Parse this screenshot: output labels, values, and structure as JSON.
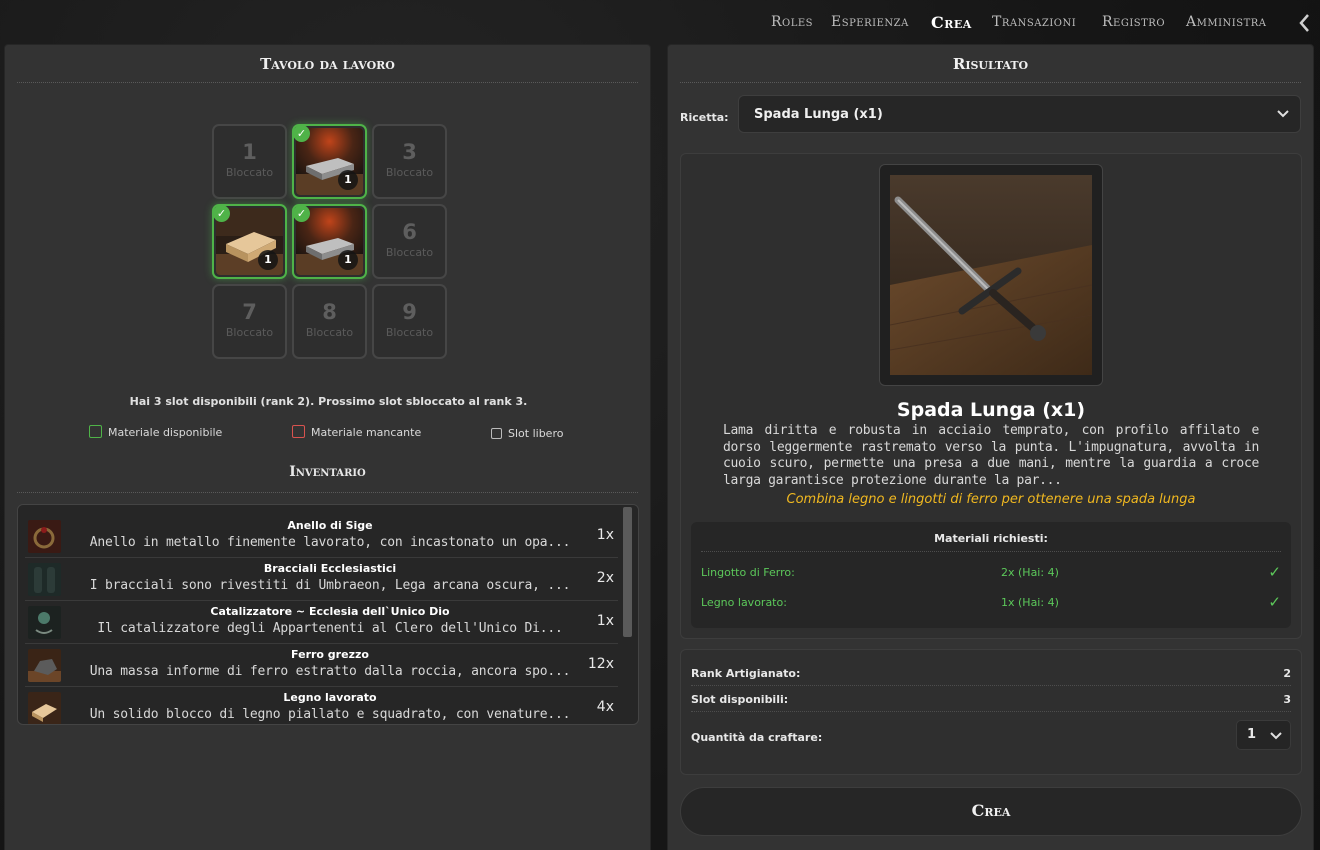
{
  "nav": {
    "items": [
      "Roles",
      "Esperienza",
      "Crea",
      "Transazioni",
      "Registro",
      "Amministra"
    ],
    "active": "Crea"
  },
  "workbench": {
    "title": "Tavolo da lavoro",
    "locked_label": "Bloccato",
    "slots": [
      {
        "num": "1",
        "state": "locked"
      },
      {
        "num": "",
        "state": "filled",
        "item": "ingot-icon",
        "qty": "1"
      },
      {
        "num": "3",
        "state": "locked"
      },
      {
        "num": "",
        "state": "filled",
        "item": "wood-plank-icon",
        "qty": "1"
      },
      {
        "num": "",
        "state": "filled",
        "item": "ingot-icon",
        "qty": "1"
      },
      {
        "num": "6",
        "state": "locked"
      },
      {
        "num": "7",
        "state": "locked"
      },
      {
        "num": "8",
        "state": "locked"
      },
      {
        "num": "9",
        "state": "locked"
      }
    ],
    "slot_info": "Hai 3 slot disponibili (rank 2). Prossimo slot sbloccato al rank 3.",
    "legend": {
      "available": "Materiale disponibile",
      "missing": "Materiale mancante",
      "free": "Slot libero"
    },
    "colors": {
      "available": "#4fb348",
      "missing": "#c0392b"
    }
  },
  "inventory": {
    "title": "Inventario",
    "items": [
      {
        "name": "Anello di Sige",
        "desc": "Anello in metallo finemente lavorato, con incastonato un opa...",
        "count": "1x",
        "thumb": "ring"
      },
      {
        "name": "Bracciali Ecclesiastici",
        "desc": "I bracciali sono rivestiti di Umbraeon, Lega arcana oscura, ...",
        "count": "2x",
        "thumb": "bracers"
      },
      {
        "name": "Catalizzatore ~ Ecclesia dell`Unico Dio",
        "desc": "Il catalizzatore degli Appartenenti al Clero dell'Unico Di...",
        "count": "1x",
        "thumb": "amulet"
      },
      {
        "name": "Ferro grezzo",
        "desc": "Una massa informe di ferro estratto dalla roccia, ancora spo...",
        "count": "12x",
        "thumb": "ore"
      },
      {
        "name": "Legno lavorato",
        "desc": "Un solido blocco di legno piallato e squadrato, con venature...",
        "count": "4x",
        "thumb": "wood"
      }
    ]
  },
  "result": {
    "title": "Risultato",
    "recipe_label": "Ricetta:",
    "recipe_value": "Spada Lunga (x1)",
    "name": "Spada Lunga (x1)",
    "description": "Lama diritta e robusta in acciaio temprato, con profilo affilato e dorso leggermente rastremato verso la punta. L'impugnatura, avvolta in cuoio scuro, permette una presa a due mani, mentre la guardia a croce larga garantisce protezione durante la par...",
    "hint": "Combina legno e lingotti di ferro per ottenere una spada lunga",
    "materials_title": "Materiali richiesti:",
    "materials": [
      {
        "name": "Lingotto di Ferro:",
        "qty": "2x (Hai: 4)",
        "ok": "✓"
      },
      {
        "name": "Legno lavorato:",
        "qty": "1x (Hai: 4)",
        "ok": "✓"
      }
    ],
    "hint_color": "#f0b820"
  },
  "stats": {
    "rank_label": "Rank Artigianato:",
    "rank_value": "2",
    "slots_label": "Slot disponibili:",
    "slots_value": "3",
    "quantity_label": "Quantità da craftare:",
    "quantity_value": "1"
  },
  "craft_button": "Crea"
}
